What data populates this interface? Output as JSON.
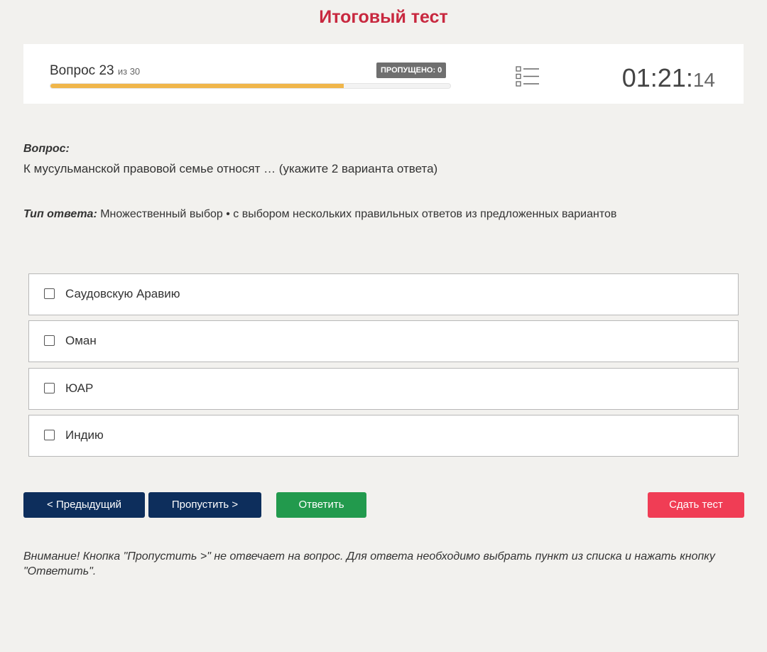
{
  "page": {
    "title": "Итоговый тест"
  },
  "header": {
    "question_label": "Вопрос 23",
    "question_of_total": "из 30",
    "skipped_badge": "ПРОПУЩЕНО: 0",
    "progress_fraction": 0.733,
    "list_icon": "question-list-icon",
    "timer_main": "01:21:",
    "timer_seconds": "14"
  },
  "question": {
    "label": "Вопрос:",
    "text": "К мусульманской правовой семье относят … (укажите 2 варианта ответа)",
    "answer_type_label": "Тип ответа:",
    "answer_type_value": " Множественный выбор • с выбором нескольких правильных ответов из предложенных вариантов"
  },
  "options": [
    {
      "label": "Саудовскую Аравию",
      "checked": false
    },
    {
      "label": "Оман",
      "checked": false
    },
    {
      "label": "ЮАР",
      "checked": false
    },
    {
      "label": "Индию",
      "checked": false
    }
  ],
  "buttons": {
    "prev": "< Предыдущий",
    "skip": "Пропустить >",
    "answer": "Ответить",
    "submit": "Сдать тест"
  },
  "colors": {
    "title": "#c8283f",
    "progress": "#f0b64a",
    "nav_button": "#0d2e5c",
    "answer_button": "#229a4d",
    "submit_button": "#f03d55"
  },
  "warning": "Внимание! Кнопка \"Пропустить >\" не отвечает на вопрос. Для ответа необходимо выбрать пункт из списка и нажать кнопку \"Ответить\"."
}
